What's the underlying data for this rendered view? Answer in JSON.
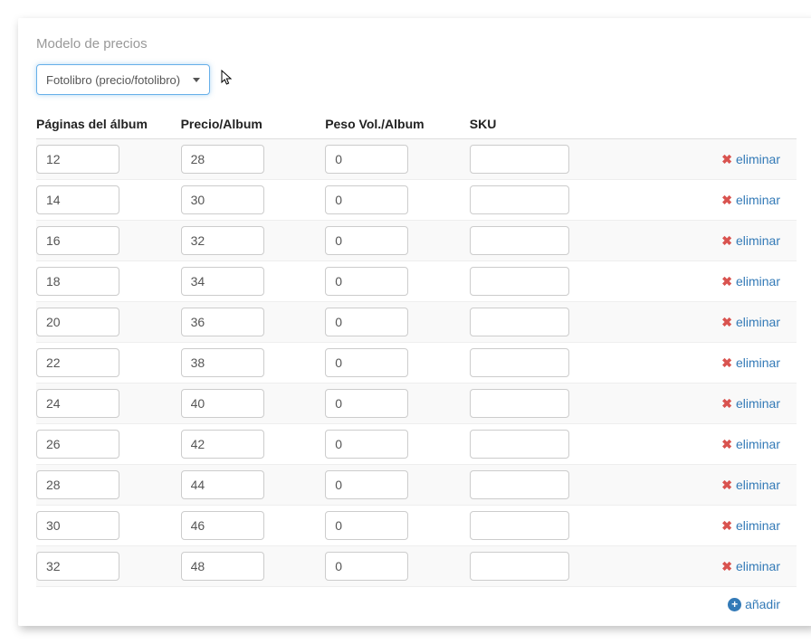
{
  "section_title": "Modelo de precios",
  "select": {
    "selected": "Fotolibro (precio/fotolibro)"
  },
  "headers": {
    "pages": "Páginas del álbum",
    "price": "Precio/Album",
    "weight": "Peso Vol./Album",
    "sku": "SKU"
  },
  "actions": {
    "delete_label": "eliminar",
    "add_label": "añadir"
  },
  "rows": [
    {
      "pages": "12",
      "price": "28",
      "weight": "0",
      "sku": ""
    },
    {
      "pages": "14",
      "price": "30",
      "weight": "0",
      "sku": ""
    },
    {
      "pages": "16",
      "price": "32",
      "weight": "0",
      "sku": ""
    },
    {
      "pages": "18",
      "price": "34",
      "weight": "0",
      "sku": ""
    },
    {
      "pages": "20",
      "price": "36",
      "weight": "0",
      "sku": ""
    },
    {
      "pages": "22",
      "price": "38",
      "weight": "0",
      "sku": ""
    },
    {
      "pages": "24",
      "price": "40",
      "weight": "0",
      "sku": ""
    },
    {
      "pages": "26",
      "price": "42",
      "weight": "0",
      "sku": ""
    },
    {
      "pages": "28",
      "price": "44",
      "weight": "0",
      "sku": ""
    },
    {
      "pages": "30",
      "price": "46",
      "weight": "0",
      "sku": ""
    },
    {
      "pages": "32",
      "price": "48",
      "weight": "0",
      "sku": ""
    }
  ]
}
